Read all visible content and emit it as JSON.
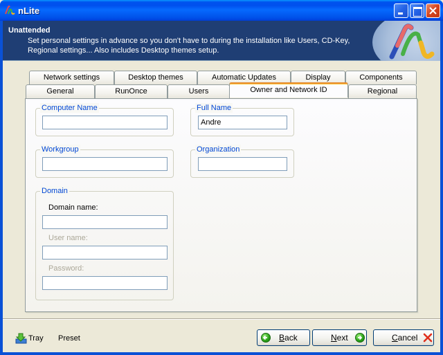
{
  "window": {
    "title": "nLite",
    "icon": "nlite-logo-icon",
    "controls": {
      "minimize": "minimize-icon",
      "maximize": "maximize-icon",
      "close": "close-icon"
    }
  },
  "header": {
    "title": "Unattended",
    "description_line1": "Set personal settings in advance so you don't have to during the installation like Users, CD-Key,",
    "description_line2": "Regional settings... Also includes Desktop themes setup."
  },
  "tabs": {
    "row_back": [
      {
        "label": "Network settings"
      },
      {
        "label": "Desktop themes"
      },
      {
        "label": "Automatic Updates"
      },
      {
        "label": "Display"
      },
      {
        "label": "Components"
      }
    ],
    "row_front": [
      {
        "label": "General"
      },
      {
        "label": "RunOnce"
      },
      {
        "label": "Users"
      },
      {
        "label": "Owner and Network ID",
        "active": true
      },
      {
        "label": "Regional"
      }
    ]
  },
  "form": {
    "computer_name": {
      "legend": "Computer Name",
      "value": ""
    },
    "full_name": {
      "legend": "Full Name",
      "value": "Andre"
    },
    "workgroup": {
      "legend": "Workgroup",
      "value": ""
    },
    "organization": {
      "legend": "Organization",
      "value": ""
    },
    "domain": {
      "legend": "Domain",
      "domain_name_label": "Domain name:",
      "domain_name_value": "",
      "user_name_label": "User name:",
      "user_name_value": "",
      "password_label": "Password:",
      "password_value": ""
    }
  },
  "footer": {
    "tray_label": "Tray",
    "tray_icon": "tray-download-icon",
    "preset_label": "Preset",
    "back": {
      "accel": "B",
      "rest": "ack"
    },
    "next": {
      "accel": "N",
      "rest": "ext"
    },
    "cancel": {
      "accel": "C",
      "rest": "ancel"
    }
  },
  "colors": {
    "header_bg": "#1f3e74",
    "legend_text": "#0046d5",
    "active_tab_accent": "#e68b2c",
    "cancel_x": "#e0301e"
  }
}
